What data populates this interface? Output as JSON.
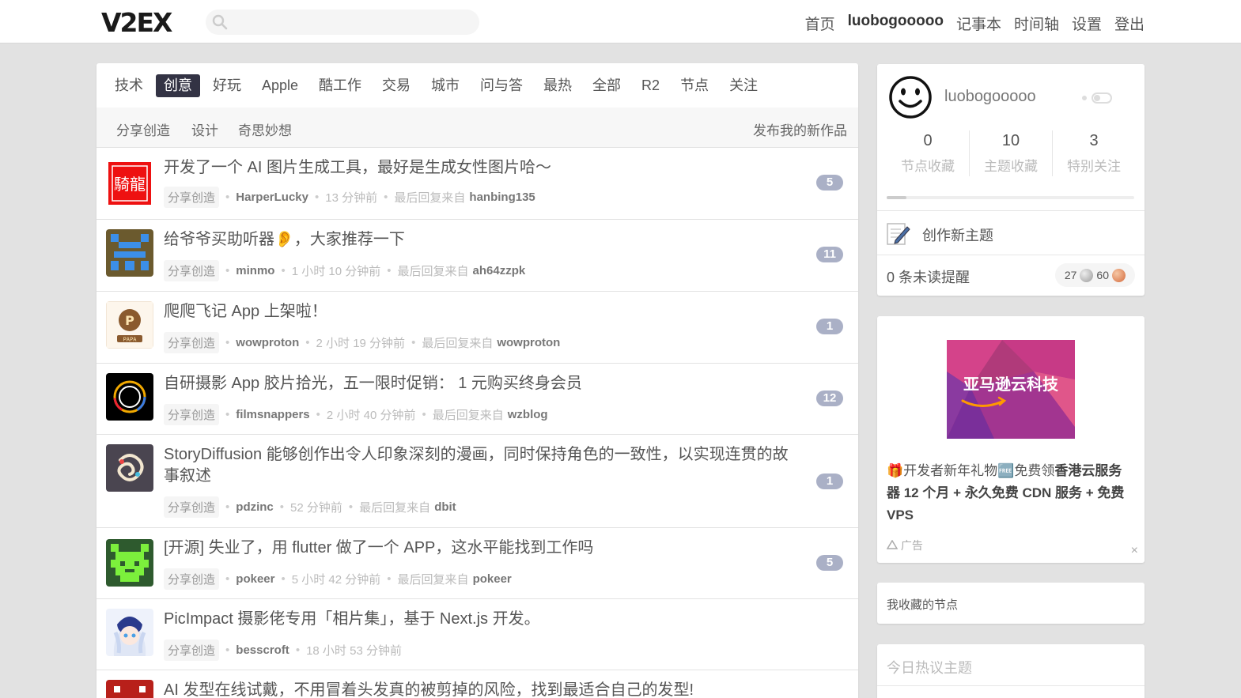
{
  "header": {
    "logo": "V2EX",
    "nav": [
      {
        "label": "首页",
        "me": false
      },
      {
        "label": "luobogooooo",
        "me": true
      },
      {
        "label": "记事本",
        "me": false
      },
      {
        "label": "时间轴",
        "me": false
      },
      {
        "label": "设置",
        "me": false
      },
      {
        "label": "登出",
        "me": false
      }
    ]
  },
  "tabs": [
    "技术",
    "创意",
    "好玩",
    "Apple",
    "酷工作",
    "交易",
    "城市",
    "问与答",
    "最热",
    "全部",
    "R2",
    "节点",
    "关注"
  ],
  "active_tab": "创意",
  "subtabs": [
    "分享创造",
    "设计",
    "奇思妙想"
  ],
  "publish_label": "发布我的新作品",
  "topics": [
    {
      "title": "开发了一个 AI 图片生成工具，最好是生成女性图片哈～",
      "node": "分享创造",
      "author": "HarperLucky",
      "time": "13 分钟前",
      "last_label": "最后回复来自",
      "last": "hanbing135",
      "count": "5"
    },
    {
      "title": "给爷爷买助听器👂，大家推荐一下",
      "node": "分享创造",
      "author": "minmo",
      "time": "1 小时 10 分钟前",
      "last_label": "最后回复来自",
      "last": "ah64zzpk",
      "count": "11"
    },
    {
      "title": "爬爬飞记 App 上架啦！",
      "node": "分享创造",
      "author": "wowproton",
      "time": "2 小时 19 分钟前",
      "last_label": "最后回复来自",
      "last": "wowproton",
      "count": "1"
    },
    {
      "title": "自研摄影 App 胶片拾光，五一限时促销： 1 元购买终身会员",
      "node": "分享创造",
      "author": "filmsnappers",
      "time": "2 小时 40 分钟前",
      "last_label": "最后回复来自",
      "last": "wzblog",
      "count": "12"
    },
    {
      "title": "StoryDiffusion 能够创作出令人印象深刻的漫画，同时保持角色的一致性，以实现连贯的故事叙述",
      "node": "分享创造",
      "author": "pdzinc",
      "time": "52 分钟前",
      "last_label": "最后回复来自",
      "last": "dbit",
      "count": "1"
    },
    {
      "title": "[开源] 失业了，用 flutter 做了一个 APP，这水平能找到工作吗",
      "node": "分享创造",
      "author": "pokeer",
      "time": "5 小时 42 分钟前",
      "last_label": "最后回复来自",
      "last": "pokeer",
      "count": "5"
    },
    {
      "title": "PicImpact 摄影佬专用「相片集」，基于 Next.js 开发。",
      "node": "分享创造",
      "author": "besscroft",
      "time": "18 小时 53 分钟前",
      "last_label": "",
      "last": "",
      "count": ""
    },
    {
      "title": "AI 发型在线试戴，不用冒着头发真的被剪掉的风险，找到最适合自己的发型!",
      "node": "",
      "author": "",
      "time": "",
      "last_label": "",
      "last": "",
      "count": ""
    }
  ],
  "user": {
    "name": "luobogooooo",
    "stats": [
      {
        "value": "0",
        "label": "节点收藏"
      },
      {
        "value": "10",
        "label": "主题收藏"
      },
      {
        "value": "3",
        "label": "特别关注"
      }
    ],
    "progress_fraction": 0.08,
    "create_label": "创作新主题",
    "unread": "0 条未读提醒",
    "silver": "27",
    "bronze": "60"
  },
  "ad": {
    "image_text": "亚马逊云科技",
    "text_prefix": "🎁开发者新年礼物🆓免费领",
    "text_bold": "香港云服务器 12 个月 + 永久免费 CDN 服务 + 免费 VPS",
    "tag": "广告",
    "close": "×"
  },
  "fav_title": "我收藏的节点",
  "hot_title": "今日热议主题"
}
